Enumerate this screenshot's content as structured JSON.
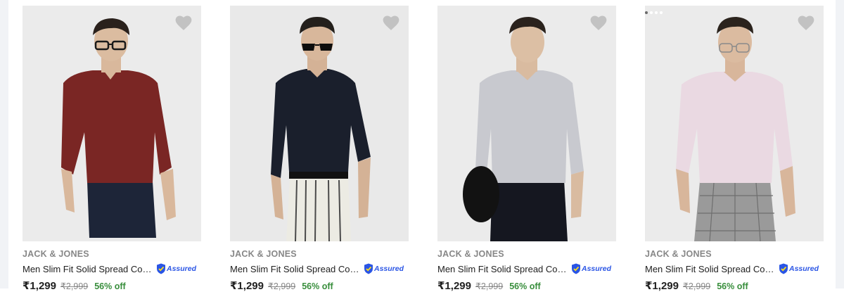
{
  "products": [
    {
      "brand": "JACK & JONES",
      "title": "Men Slim Fit Solid Spread Collar Casual Shirt",
      "assured": "Assured",
      "price": "₹1,299",
      "mrp": "₹2,999",
      "discount": "56% off",
      "shirt_color": "#7a2624",
      "pants_color": "#1d2538",
      "eyewear": "glasses",
      "wishlist_icon": "heart-icon"
    },
    {
      "brand": "JACK & JONES",
      "title": "Men Slim Fit Solid Spread Collar Casual Shirt",
      "assured": "Assured",
      "price": "₹1,299",
      "mrp": "₹2,999",
      "discount": "56% off",
      "shirt_color": "#1a1f2c",
      "pants_color": "#ecebe3",
      "eyewear": "sunglasses",
      "wishlist_icon": "heart-icon"
    },
    {
      "brand": "JACK & JONES",
      "title": "Men Slim Fit Solid Spread Collar Casual Shirt",
      "assured": "Assured",
      "price": "₹1,299",
      "mrp": "₹2,999",
      "discount": "56% off",
      "shirt_color": "#c8c9cf",
      "pants_color": "#151720",
      "eyewear": "none",
      "wishlist_icon": "heart-icon"
    },
    {
      "brand": "JACK & JONES",
      "title": "Men Slim Fit Solid Spread Collar Casual Shirt",
      "assured": "Assured",
      "price": "₹1,299",
      "mrp": "₹2,999",
      "discount": "56% off",
      "shirt_color": "#ead9e2",
      "pants_color": "#9a9a9a",
      "eyewear": "glasses",
      "wishlist_icon": "heart-icon"
    }
  ]
}
